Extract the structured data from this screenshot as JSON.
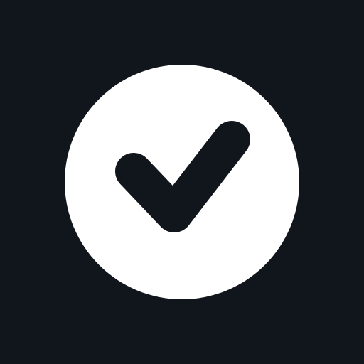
{
  "icon": {
    "name": "check-circle-icon",
    "background_color": "#11161d",
    "circle_color": "#ffffff",
    "check_color": "#11161d"
  }
}
